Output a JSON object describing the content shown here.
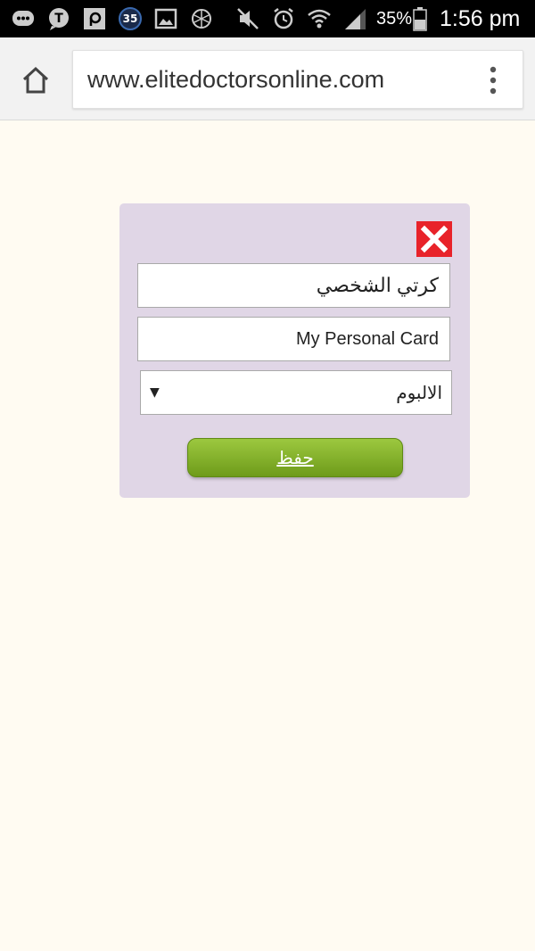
{
  "status_bar": {
    "notification_badge": "35",
    "battery_percent": "35%",
    "time": "1:56 pm",
    "icons": [
      "messaging-icon",
      "t-app-icon",
      "p-app-icon",
      "badge-35-icon",
      "gallery-icon",
      "game-icon",
      "mute-icon",
      "alarm-icon",
      "wifi-icon",
      "signal-icon",
      "battery-icon"
    ]
  },
  "browser": {
    "url": "www.elitedoctorsonline.com",
    "icons": [
      "home-icon",
      "more-vert-icon"
    ]
  },
  "dialog": {
    "arabic_title_value": "كرتي الشخصي",
    "english_title_value": "My Personal Card",
    "album_select_value": "الالبوم",
    "save_label": "حفظ",
    "close_color": "#e8232a",
    "save_color": "#84b22a",
    "background_color": "#e0d6e6"
  }
}
